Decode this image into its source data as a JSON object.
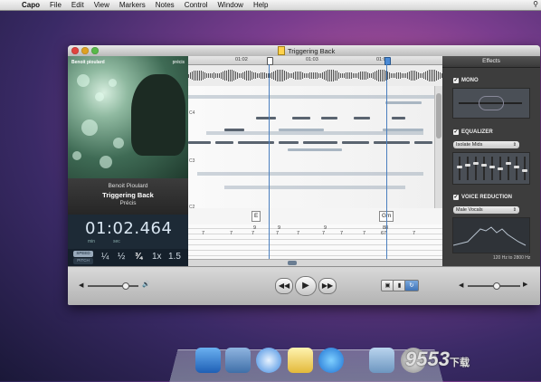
{
  "menubar": {
    "apple": "",
    "items": [
      "Capo",
      "File",
      "Edit",
      "View",
      "Markers",
      "Notes",
      "Control",
      "Window",
      "Help"
    ]
  },
  "window": {
    "title": "Triggering Back"
  },
  "album": {
    "art_artist": "Benoit pioulard",
    "art_album": "précis",
    "artist": "Benoit Pioulard",
    "track": "Triggering Back",
    "album": "Précis"
  },
  "time": {
    "value": "01:02.464",
    "min_label": "min",
    "sec_label": "sec"
  },
  "speed": {
    "speed_label": "SPEED",
    "pitch_label": "PITCH",
    "options": [
      "¼",
      "½",
      "¾",
      "1x",
      "1.5"
    ],
    "selected": "¾"
  },
  "ruler": {
    "labels": [
      "01:02",
      "01:03",
      "01:04"
    ]
  },
  "notes": {
    "labels": [
      "C4",
      "C3",
      "C2"
    ]
  },
  "chords": [
    "E",
    "Gm"
  ],
  "tab": {
    "cols": [
      {
        "a": "",
        "b": "7"
      },
      {
        "a": "",
        "b": "7"
      },
      {
        "a": "9",
        "b": "7"
      },
      {
        "a": "9",
        "b": "7"
      },
      {
        "a": "",
        "b": "7"
      },
      {
        "a": "9",
        "b": "7"
      },
      {
        "a": "",
        "b": "7"
      },
      {
        "a": "",
        "b": "7"
      },
      {
        "a": "8",
        "b": "6"
      },
      {
        "a": "8",
        "b": "7"
      },
      {
        "a": "",
        "b": "7"
      }
    ]
  },
  "effects": {
    "title": "Effects",
    "mono": "MONO",
    "equalizer": "EQUALIZER",
    "eq_preset": "Isolate Mids",
    "voice": "VOICE REDUCTION",
    "voice_preset": "Male Vocals",
    "range": "120 Hz to 2800 Hz"
  },
  "transport": {
    "rewind": "◀◀",
    "play": "▶",
    "forward": "▶▶"
  },
  "watermark": {
    "num": "9553",
    "cn": "下载"
  }
}
